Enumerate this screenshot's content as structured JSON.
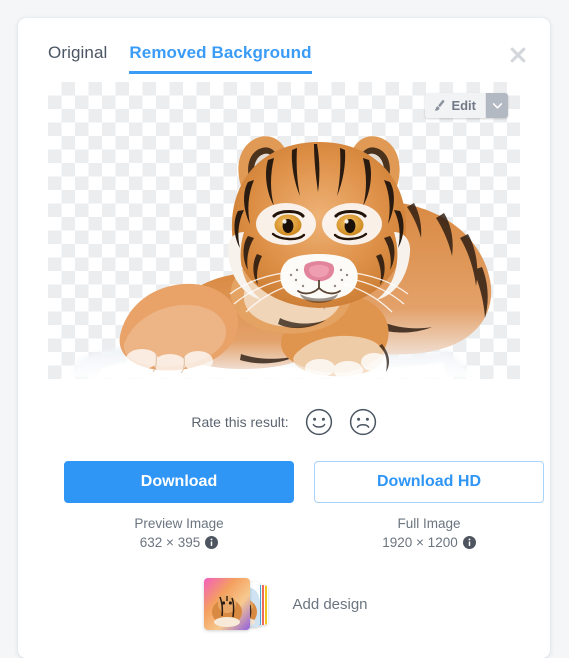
{
  "window": {
    "background_color": "#f4f6f8",
    "card_color": "#ffffff"
  },
  "theme": {
    "accent_blue": "#2f96f6",
    "tab_active_blue": "#3b9cf7",
    "outline_blue": "#a8d3fb",
    "text_gray": "#6b7580",
    "close_gray": "#d3d6da"
  },
  "tabs": [
    {
      "label": "Original",
      "active": false
    },
    {
      "label": "Removed Background",
      "active": true
    }
  ],
  "close_button": {
    "icon": "close-icon",
    "label": "Close"
  },
  "preview": {
    "background": "transparency-checkerboard",
    "subject": "tiger",
    "edit_button": {
      "label": "Edit",
      "icon": "paintbrush-icon",
      "dropdown_icon": "chevron-down-icon"
    }
  },
  "rating": {
    "label": "Rate this result:",
    "options": [
      {
        "icon": "smiley-happy-icon",
        "name": "happy"
      },
      {
        "icon": "smiley-sad-icon",
        "name": "sad"
      }
    ]
  },
  "downloads": [
    {
      "button_label": "Download",
      "style": "primary",
      "caption": "Preview Image",
      "size": "632 × 395",
      "info_icon": "info-icon"
    },
    {
      "button_label": "Download HD",
      "style": "outline",
      "caption": "Full Image",
      "size": "1920 × 1200",
      "info_icon": "info-icon"
    }
  ],
  "add_design": {
    "label": "Add design",
    "thumbnails": [
      {
        "name": "design-thumb-gradient"
      },
      {
        "name": "design-thumb-arc"
      },
      {
        "name": "design-thumb-stripes"
      }
    ]
  }
}
